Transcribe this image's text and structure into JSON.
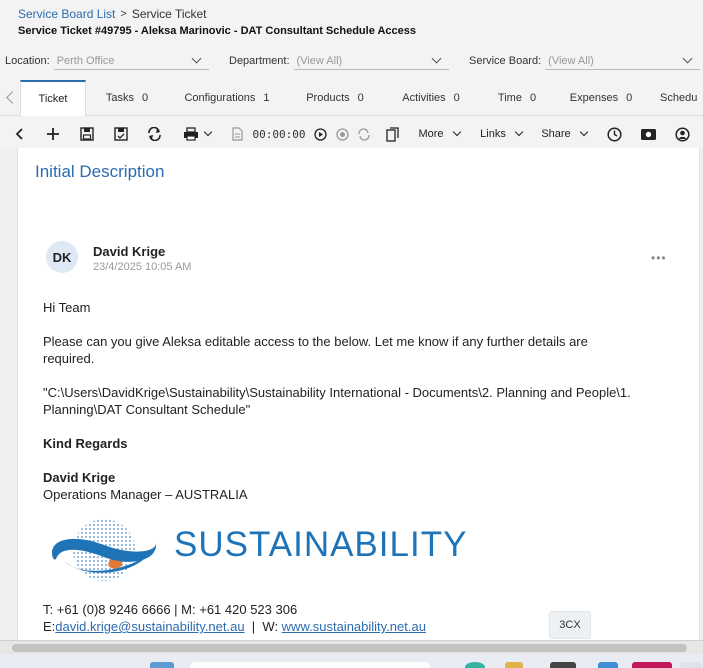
{
  "breadcrumb": {
    "parent": "Service Board List",
    "current": "Service Ticket"
  },
  "ticket": {
    "title": "Service Ticket #49795 - Aleksa Marinovic - DAT Consultant Schedule Access"
  },
  "filters": {
    "location": {
      "label": "Location:",
      "value": "Perth Office"
    },
    "department": {
      "label": "Department:",
      "value": "(View All)"
    },
    "service_board": {
      "label": "Service Board:",
      "value": "(View All)"
    }
  },
  "tabs": [
    {
      "label": "Ticket",
      "count": ""
    },
    {
      "label": "Tasks",
      "count": "0"
    },
    {
      "label": "Configurations",
      "count": "1"
    },
    {
      "label": "Products",
      "count": "0"
    },
    {
      "label": "Activities",
      "count": "0"
    },
    {
      "label": "Time",
      "count": "0"
    },
    {
      "label": "Expenses",
      "count": "0"
    },
    {
      "label": "Schedu",
      "count": ""
    }
  ],
  "toolbar": {
    "timer": "00:00:00",
    "more_label": "More",
    "links_label": "Links",
    "share_label": "Share"
  },
  "section": {
    "title": "Initial Description"
  },
  "note": {
    "avatar_initials": "DK",
    "author": "David Krige",
    "timestamp": "23/4/2025 10:05 AM",
    "greeting": "Hi Team",
    "para1_line1": "Please can you give Aleksa editable access to the below. Let me know if any further details are",
    "para1_line2": "required.",
    "path_line1": "\"C:\\Users\\DavidKrige\\Sustainability\\Sustainability International - Documents\\2. Planning and People\\1.",
    "path_line2": "Planning\\DAT Consultant Schedule\"",
    "sign_off": "Kind Regards",
    "sig_name": "David Krige",
    "sig_title": "Operations Manager – AUSTRALIA",
    "logo_text": "SUSTAINABILITY",
    "phone_line": "T: +61 (0)8 9246 6666   |  M: +61 420 523 306",
    "email_prefix": "E:",
    "email": "david.krige@sustainability.net.au",
    "web_sep": "  |  W: ",
    "website": "www.sustainability.net.au"
  },
  "widgets": {
    "badge": "3CX"
  },
  "icons": [
    "back-icon",
    "add-icon",
    "save-icon",
    "save-and-close-icon",
    "refresh-icon",
    "print-icon",
    "time-entry-icon",
    "play-icon",
    "stop-icon",
    "reset-icon",
    "copy-icon",
    "clock-icon",
    "money-icon",
    "user-icon",
    "more-dots-icon"
  ],
  "colors": {
    "accent": "#2b6cb0",
    "logo_blue": "#1f74b8"
  }
}
